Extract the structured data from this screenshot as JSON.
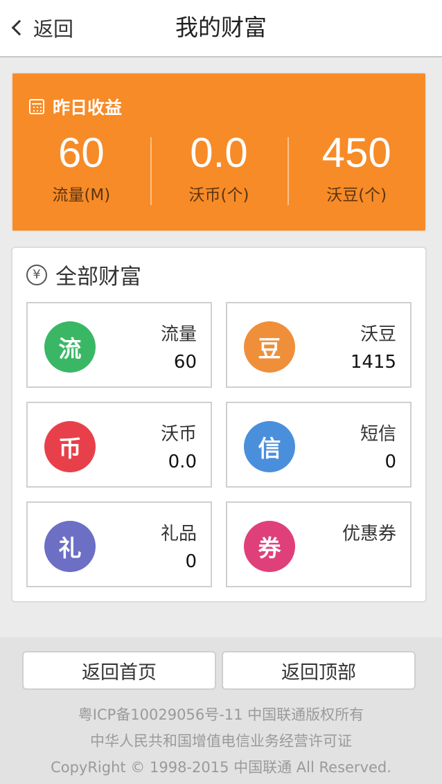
{
  "header": {
    "back_label": "返回",
    "title": "我的财富"
  },
  "yesterday": {
    "title": "昨日收益",
    "icon": "calendar-icon",
    "stats": [
      {
        "value": "60",
        "unit": "流量(M)"
      },
      {
        "value": "0.0",
        "unit": "沃币(个)"
      },
      {
        "value": "450",
        "unit": "沃豆(个)"
      }
    ]
  },
  "wealth": {
    "title": "全部财富",
    "icon": "yen-icon",
    "items": [
      {
        "glyph": "流",
        "label": "流量",
        "value": "60",
        "color": "#3ab765"
      },
      {
        "glyph": "豆",
        "label": "沃豆",
        "value": "1415",
        "color": "#ef8f3a"
      },
      {
        "glyph": "币",
        "label": "沃币",
        "value": "0.0",
        "color": "#e8404a"
      },
      {
        "glyph": "信",
        "label": "短信",
        "value": "0",
        "color": "#4a8fdc"
      },
      {
        "glyph": "礼",
        "label": "礼品",
        "value": "0",
        "color": "#6c6fc4"
      },
      {
        "glyph": "券",
        "label": "优惠券",
        "value": "",
        "color": "#e0407a"
      }
    ]
  },
  "footer": {
    "home_label": "返回首页",
    "top_label": "返回顶部",
    "icp": "粤ICP备10029056号-11 中国联通版权所有",
    "license": "中华人民共和国增值电信业务经营许可证",
    "copyright": "CopyRight © 1998-2015 中国联通 All Reserved."
  },
  "colors": {
    "accent": "#f78b27"
  }
}
